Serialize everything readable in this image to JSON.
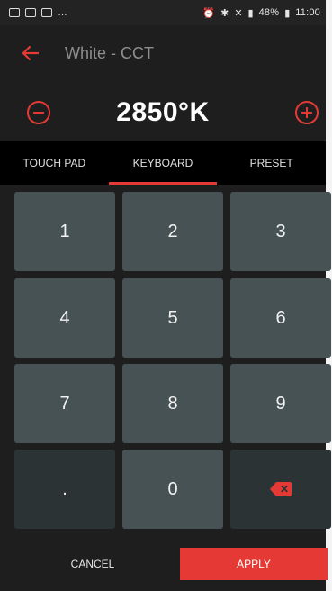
{
  "status_bar": {
    "left_glyphs": "…",
    "battery_text": "48%",
    "time": "11:00"
  },
  "header": {
    "title": "White - CCT"
  },
  "temperature": {
    "value": "2850°K"
  },
  "tabs": [
    {
      "label": "TOUCH PAD",
      "active": false
    },
    {
      "label": "KEYBOARD",
      "active": true
    },
    {
      "label": "PRESET",
      "active": false
    }
  ],
  "keypad": {
    "keys": [
      "1",
      "2",
      "3",
      "4",
      "5",
      "6",
      "7",
      "8",
      "9",
      ".",
      "0"
    ]
  },
  "actions": {
    "cancel_label": "CANCEL",
    "apply_label": "APPLY"
  },
  "colors": {
    "accent": "#e53935",
    "background": "#1e1e1e",
    "key": "#465253",
    "key_dark": "#2b3334",
    "tab_bar": "#000000"
  }
}
